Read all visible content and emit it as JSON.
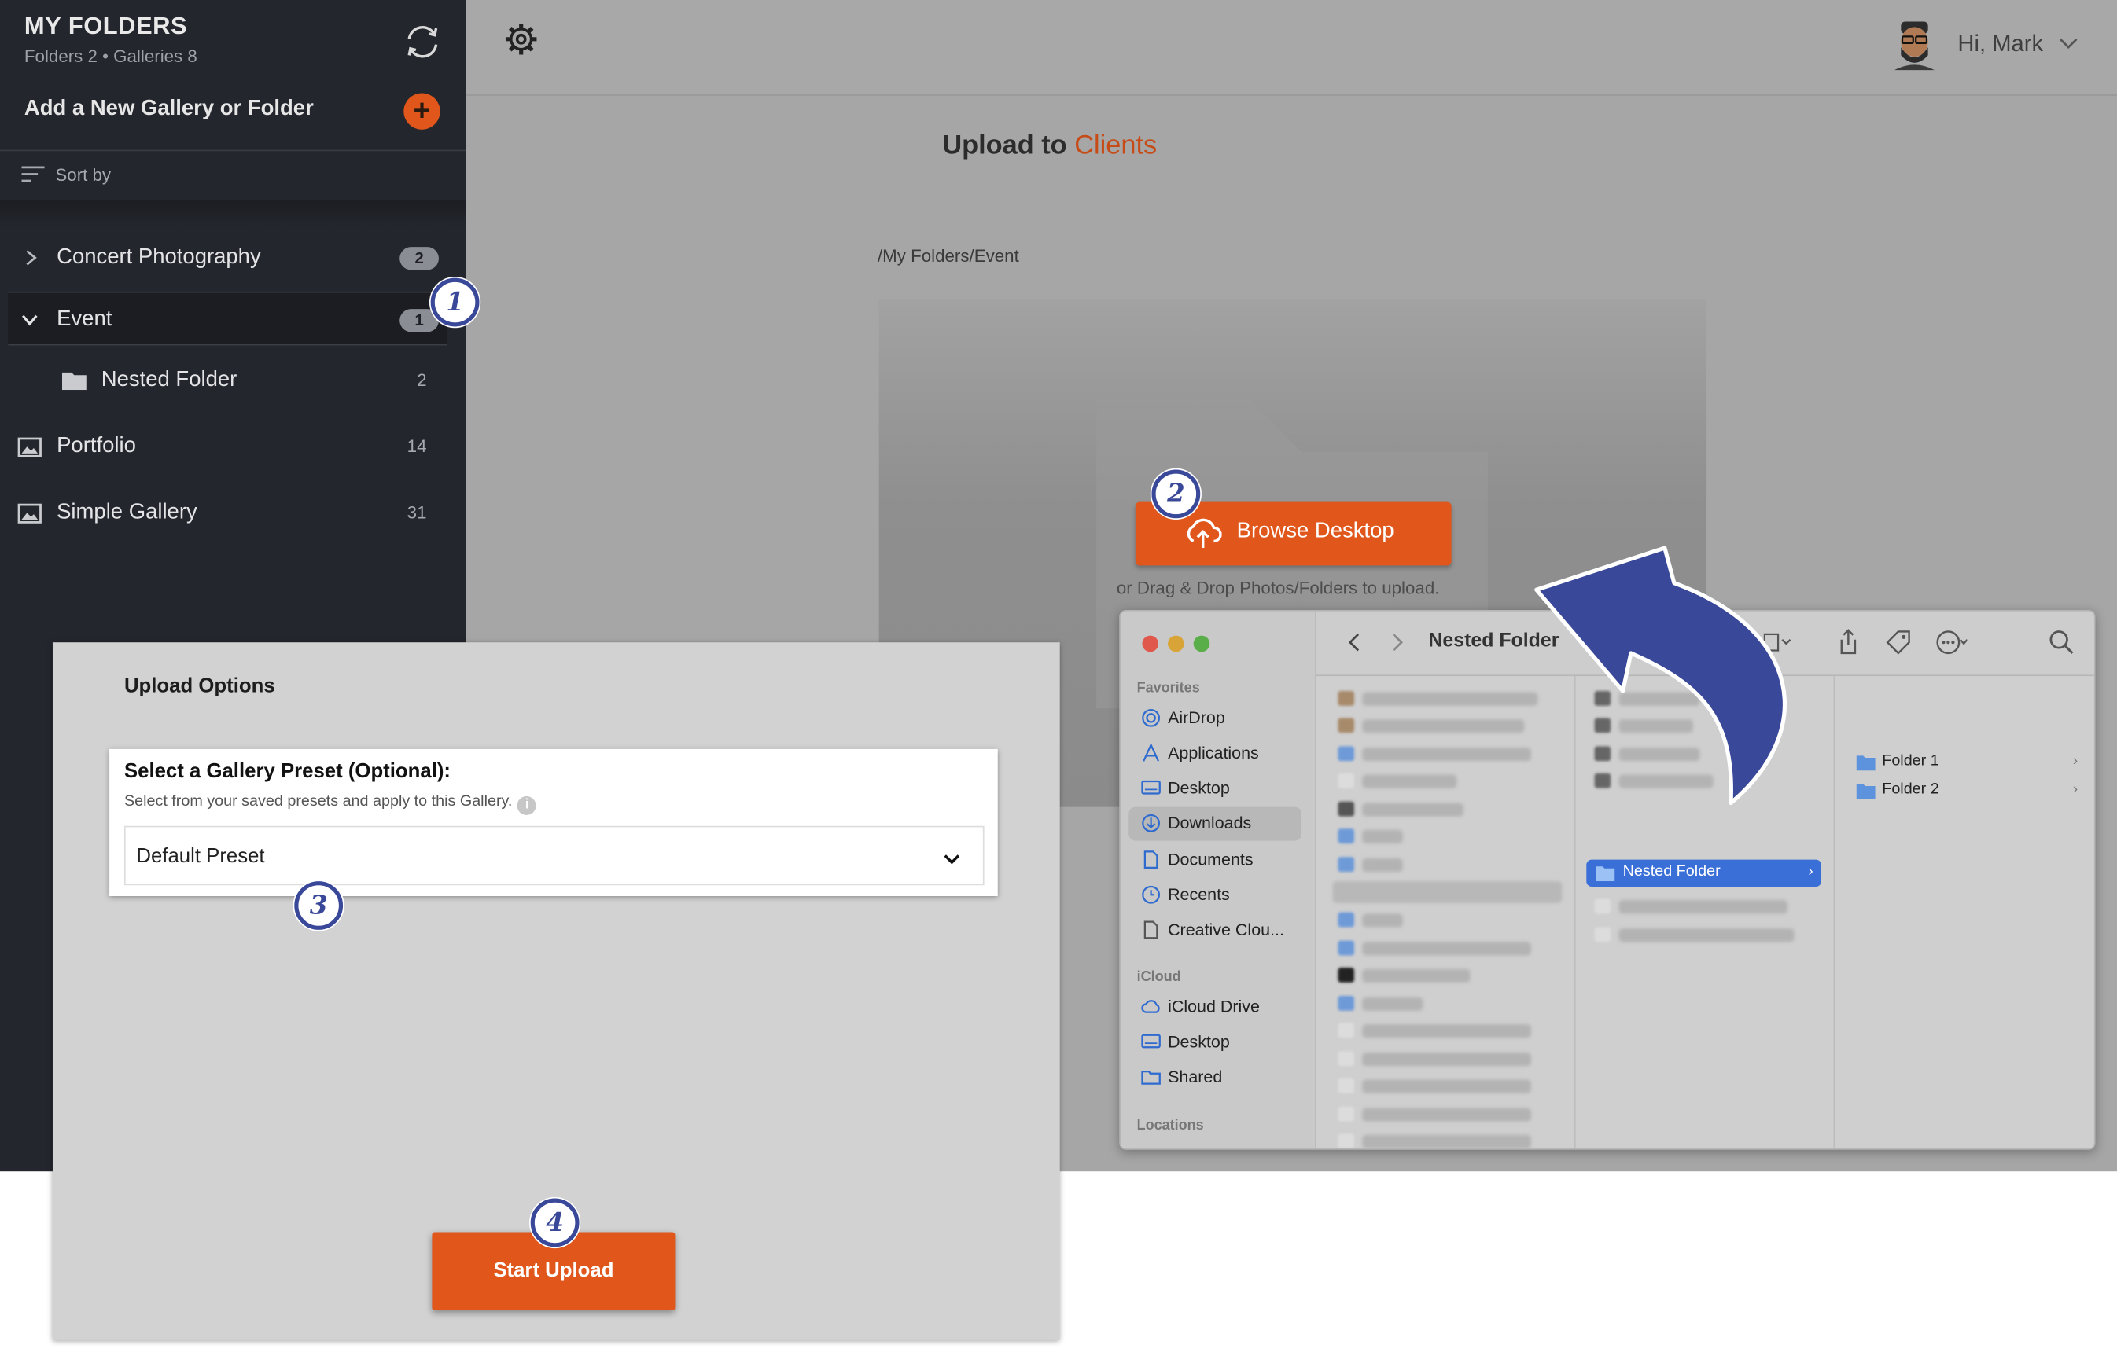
{
  "sidebar": {
    "title": "MY FOLDERS",
    "subtitle": "Folders 2 • Galleries 8",
    "add_label": "Add a New Gallery or Folder",
    "add_symbol": "+",
    "sort_label": "Sort by",
    "items": [
      {
        "label": "Concert Photography",
        "count": "2",
        "icon": "chevron-right-icon"
      },
      {
        "label": "Event",
        "count": "1",
        "icon": "chevron-down-icon"
      },
      {
        "label": "Nested Folder",
        "count": "2",
        "icon": "folder-icon"
      },
      {
        "label": "Portfolio",
        "count": "14",
        "icon": "gallery-image-icon"
      },
      {
        "label": "Simple Gallery",
        "count": "31",
        "icon": "gallery-image-icon"
      }
    ]
  },
  "header": {
    "greeting": "Hi, Mark"
  },
  "upload": {
    "title_prefix": "Upload to ",
    "title_target": "Clients",
    "path": "/My Folders/Event",
    "browse_label": "Browse Desktop",
    "drop_hint": "or Drag & Drop Photos/Folders to upload."
  },
  "options": {
    "title": "Upload Options",
    "preset_label": "Select a Gallery Preset (Optional):",
    "preset_help": "Select from your saved presets and apply to this Gallery.",
    "info_symbol": "i",
    "preset_value": "Default Preset",
    "start_label": "Start Upload"
  },
  "finder": {
    "title": "Nested Folder",
    "favorites_heading": "Favorites",
    "favorites": [
      "AirDrop",
      "Applications",
      "Desktop",
      "Downloads",
      "Documents",
      "Recents",
      "Creative Clou..."
    ],
    "icloud_heading": "iCloud",
    "icloud": [
      "iCloud Drive",
      "Desktop",
      "Shared"
    ],
    "locations_heading": "Locations",
    "selected_folder": "Nested Folder",
    "subfolders": [
      "Folder 1",
      "Folder 2"
    ],
    "chevron": "›"
  },
  "markers": [
    "1",
    "2",
    "3",
    "4"
  ],
  "colors": {
    "accent": "#e0561b",
    "accent_text": "#c64b17",
    "sidebar_bg": "#23262d",
    "marker": "#3a4899",
    "finder_selection": "#3a6fd8"
  }
}
